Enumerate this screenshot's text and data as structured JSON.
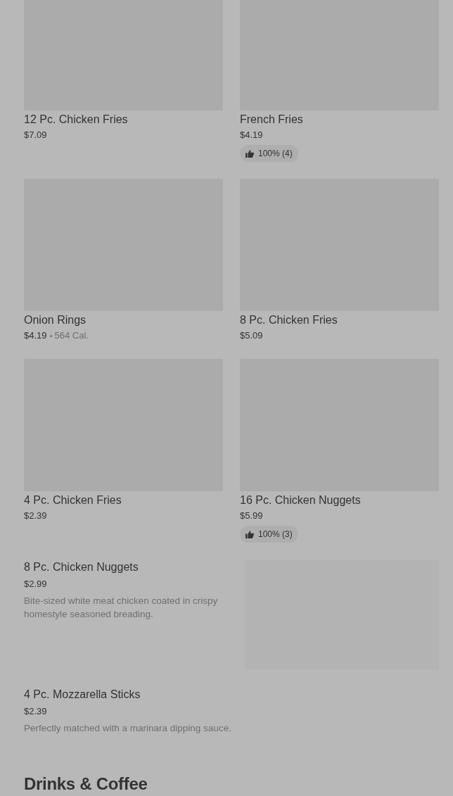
{
  "grid_items": [
    {
      "name": "12 Pc. Chicken Fries",
      "price": "$7.09"
    },
    {
      "name": "French Fries",
      "price": "$4.19",
      "rating": "100% (4)"
    },
    {
      "name": "Onion Rings",
      "price": "$4.19",
      "calories": "564 Cal."
    },
    {
      "name": "8 Pc. Chicken Fries",
      "price": "$5.09"
    },
    {
      "name": "4 Pc. Chicken Fries",
      "price": "$2.39"
    },
    {
      "name": "16 Pc. Chicken Nuggets",
      "price": "$5.99",
      "rating": "100% (3)"
    }
  ],
  "list_items": [
    {
      "name": "8 Pc. Chicken Nuggets",
      "price": "$2.99",
      "description": "Bite-sized white meat chicken coated in crispy homestyle seasoned breading.",
      "image": true
    },
    {
      "name": "4 Pc. Mozzarella Sticks",
      "price": "$2.39",
      "description": "Perfectly matched with a marinara dipping sauce.",
      "image": false
    }
  ],
  "next_section": {
    "title": "Drinks & Coffee"
  }
}
